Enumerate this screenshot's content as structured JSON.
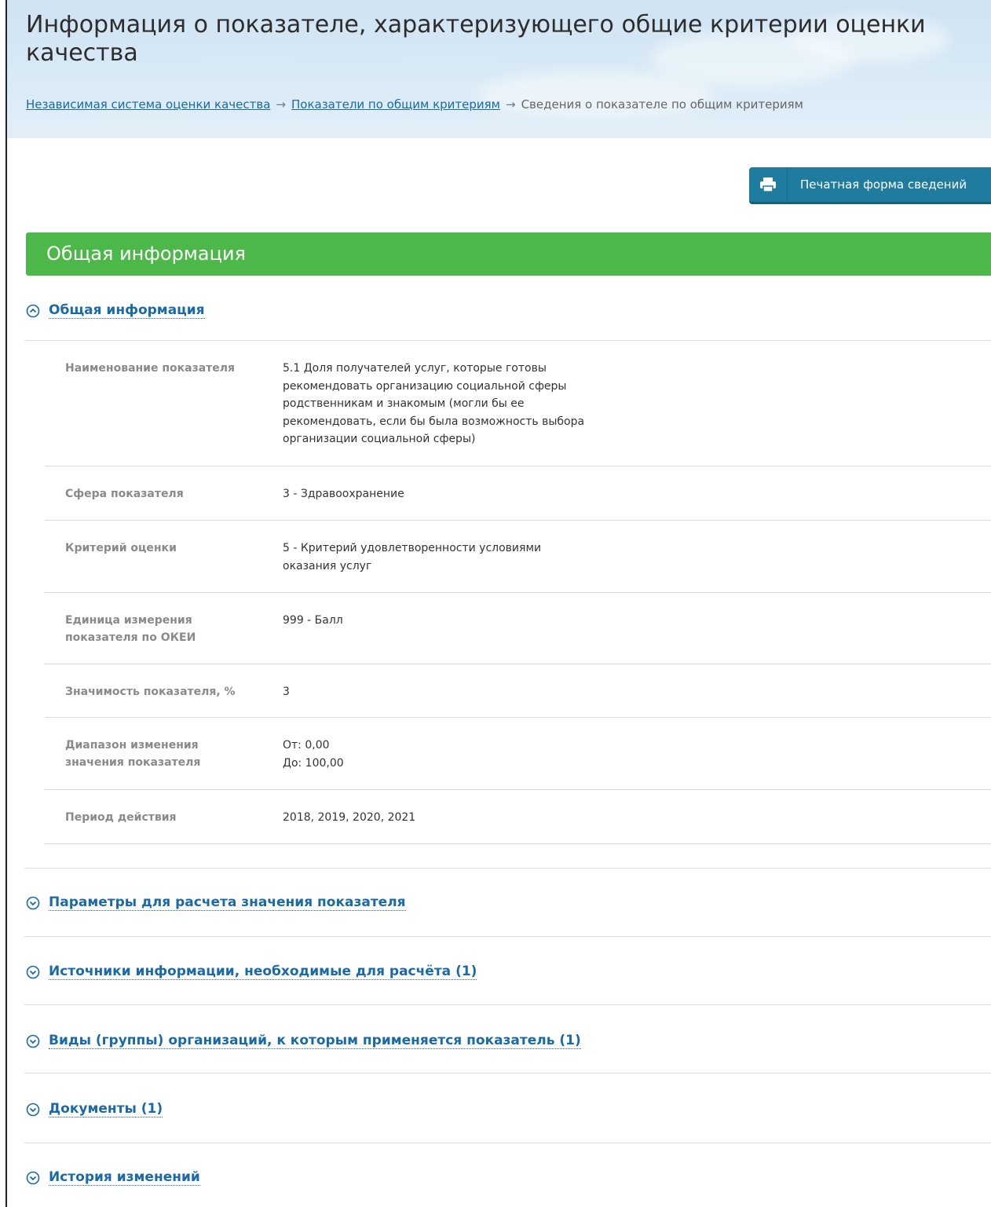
{
  "page": {
    "title": "Информация о показателе, характеризующего общие критерии оценки качества"
  },
  "breadcrumb": {
    "items": [
      {
        "label": "Независимая система оценки качества"
      },
      {
        "label": "Показатели по общим критериям"
      }
    ],
    "current": "Сведения о показателе по общим критериям",
    "separator": "→"
  },
  "actions": {
    "print_label": "Печатная форма сведений",
    "print_icon": "printer-icon"
  },
  "section": {
    "title": "Общая информация"
  },
  "general_info": {
    "toggle_label": "Общая информация",
    "expanded": true,
    "rows": [
      {
        "key": "Наименование показателя",
        "value": [
          "5.1 Доля получателей услуг, которые готовы рекомендовать организацию социальной сферы родственникам и знакомым (могли бы ее рекомендовать, если бы была возможность выбора организации социальной сферы)"
        ]
      },
      {
        "key": "Сфера показателя",
        "value": [
          "3 - Здравоохранение"
        ]
      },
      {
        "key": "Критерий оценки",
        "value": [
          "5 - Критерий удовлетворенности условиями оказания услуг"
        ]
      },
      {
        "key": "Единица измерения показателя по ОКЕИ",
        "value": [
          "999 - Балл"
        ]
      },
      {
        "key": "Значимость показателя, %",
        "value": [
          "3"
        ]
      },
      {
        "key": "Диапазон изменения значения показателя",
        "value": [
          "От: 0,00",
          "До: 100,00"
        ]
      },
      {
        "key": "Период действия",
        "value": [
          "2018, 2019, 2020, 2021"
        ]
      }
    ]
  },
  "accordions": [
    {
      "label": "Параметры для расчета значения показателя",
      "expanded": false
    },
    {
      "label": "Источники информации, необходимые для расчёта (1)",
      "expanded": false
    },
    {
      "label": "Виды (группы) организаций, к которым применяется показатель (1)",
      "expanded": false
    },
    {
      "label": "Документы (1)",
      "expanded": false
    },
    {
      "label": "История изменений",
      "expanded": false
    }
  ],
  "colors": {
    "header_bg": "#d6e8f5",
    "section_green": "#4cb84a",
    "print_button": "#1f7c9e",
    "link": "#1a6aa7"
  }
}
